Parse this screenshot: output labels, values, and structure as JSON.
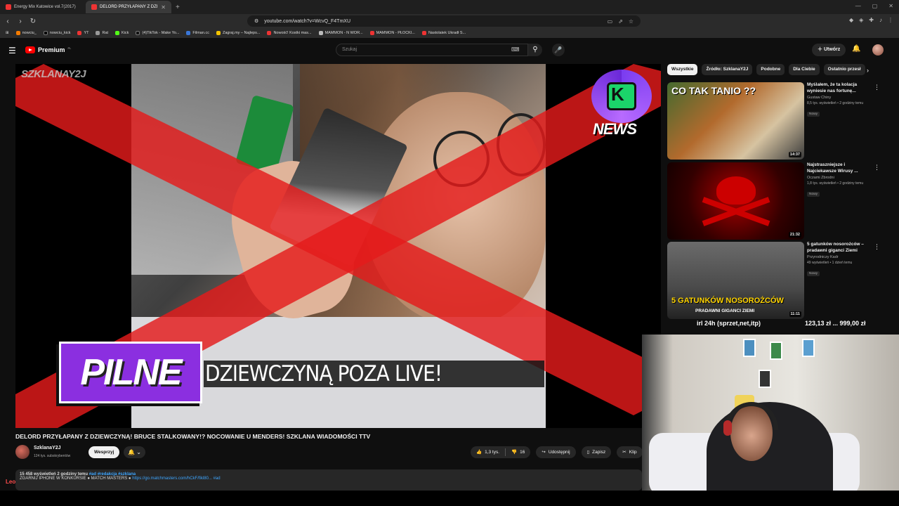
{
  "browser": {
    "tabs": [
      {
        "label": "Energy Mix Katowice vol.7(2017)",
        "active": false
      },
      {
        "label": "DELORD PRZYŁAPANY Z DZI",
        "active": true
      }
    ],
    "url": "youtube.com/watch?v=WcvQ_F4TmXU",
    "bookmarks": [
      "nowciu_",
      "nowciu_kick",
      "YT",
      "Rat",
      "Kick",
      "(4)TikTok - Make Yo...",
      "Filman.cc",
      "Zagraj.my – Najleps...",
      "Nowość! Kostki mas...",
      "MAMMON - N WOR...",
      "MAMMON - PŁOCKI...",
      "Nastolatek Ukradł S..."
    ]
  },
  "header": {
    "logo": "Premium",
    "logo_country": "PL",
    "search_placeholder": "Szukaj",
    "create_label": "Utwórz"
  },
  "video": {
    "watermark": "SZKLANAY2J",
    "badge_label": "NEWS",
    "overlay_pilne": "PILNE",
    "overlay_banner": "DZIEWCZYNĄ POZA LIVE!"
  },
  "meta": {
    "title": "DELORD PRZYŁAPANY Z DZIEWCZYNĄ! BRUCE STALKOWANY!? NOCOWANIE U MENDERS! SZKLANA WIADOMOŚCI TTV",
    "channel": "SzklanaY2J",
    "subscribers": "124 tys. subskrybentów",
    "support_label": "Wesprzyj",
    "likes": "1,3 tys.",
    "dislikes": "16",
    "share_label": "Udostępnij",
    "save_label": "Zapisz",
    "clip_label": "Klip",
    "views_line": "15 458 wyświetleń  2 godziny temu",
    "tags": "#ad #redakcja #szklana",
    "desc_line2": "ZGARNIJ IPHONE W KONKURSIE",
    "desc_line2b": "MATCH MASTERS",
    "desc_link": "https://go.matchmasters.com/hCkF/fikl80...",
    "desc_ad": "#ad",
    "overlay_name": "Leo"
  },
  "sidebar": {
    "chips": [
      "Wszystkie",
      "Źródło: SzklanaY2J",
      "Podobne",
      "Dla Ciebie",
      "Ostatnio przesł"
    ],
    "recs": [
      {
        "title": "Myślałem, że ta kolacja wyniesie nas fortunę...",
        "channel": "Gustaw Chiny",
        "meta": "8,5 tys. wyświetleń • 2 godziny temu",
        "badge": "Nowy",
        "duration": "14:37",
        "thumb_caption": "CO TAK TANIO ??"
      },
      {
        "title": "Najstraszniejsze i Najciekawsze Wirusy ...",
        "channel": "Oczami Zbrodni",
        "meta": "1,8 tys. wyświetleń • 2 godziny temu",
        "badge": "Nowy",
        "duration": "21:32",
        "thumb_caption": ""
      },
      {
        "title": "5 gatunków nosorożców – pradawni giganci Ziemi",
        "channel": "Przyrodniczy Kadr",
        "meta": "49 wyświetleń • 1 dzień temu",
        "badge": "Nowy",
        "duration": "11:11",
        "thumb_caption": "5 GATUNKÓW NOSOROŻCÓW",
        "thumb_sub": "PRADAWNI GIGANCI ZIEMI"
      }
    ],
    "ticker_left": "irl 24h (sprzet,net,itp)",
    "ticker_right": "123,13 zł ... 999,00 zł"
  }
}
